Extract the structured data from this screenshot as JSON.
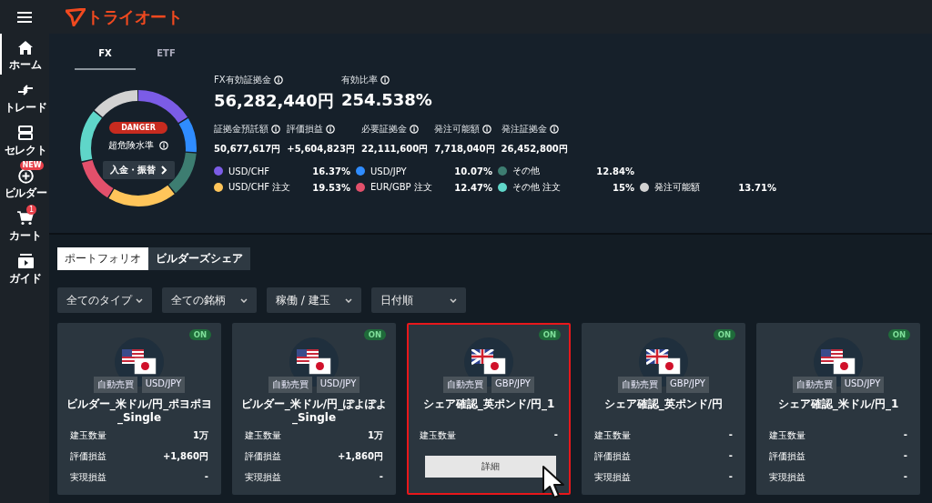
{
  "header": {
    "logo": "トライオート"
  },
  "sidebar": {
    "items": [
      {
        "label": "ホーム",
        "selected": true
      },
      {
        "label": "トレード",
        "selected": false
      },
      {
        "label": "セレクト",
        "selected": false
      },
      {
        "label": "ビルダー",
        "selected": false,
        "badge": "NEW"
      },
      {
        "label": "カート",
        "selected": false,
        "count": "1"
      },
      {
        "label": "ガイド",
        "selected": false
      }
    ]
  },
  "asset_tabs": [
    {
      "label": "FX",
      "selected": true
    },
    {
      "label": "ETF",
      "selected": false
    }
  ],
  "risk": {
    "badge": "DANGER",
    "level_text": "超危険水準",
    "button": "入金・振替"
  },
  "summary": [
    {
      "label": "FX有効証拠金",
      "value": "56,282,440円"
    },
    {
      "label": "有効比率",
      "value": "254.538%"
    }
  ],
  "details": [
    {
      "label": "証拠金預託額",
      "value": "50,677,617円"
    },
    {
      "label": "評価損益",
      "value": "+5,604,823円"
    },
    {
      "label": "必要証拠金",
      "value": "22,111,600円"
    },
    {
      "label": "発注可能額",
      "value": "7,718,040円"
    },
    {
      "label": "発注証拠金",
      "value": "26,452,800円"
    }
  ],
  "legend_rows": [
    [
      {
        "label": "USD/CHF",
        "percent": "16.37%",
        "color": "#7b5ce6"
      },
      {
        "label": "USD/JPY",
        "percent": "10.07%",
        "color": "#2f8cff"
      },
      {
        "label": "その他",
        "percent": "12.84%",
        "color": "#3d7d71"
      }
    ],
    [
      {
        "label": "USD/CHF 注文",
        "percent": "19.53%",
        "color": "#ffc55a"
      },
      {
        "label": "EUR/GBP 注文",
        "percent": "12.47%",
        "color": "#e2506b"
      },
      {
        "label": "その他 注文",
        "percent": "15%",
        "color": "#5fd6c9"
      },
      {
        "label": "発注可能額",
        "percent": "13.71%",
        "color": "#d2d2d2"
      }
    ]
  ],
  "view_tabs": [
    {
      "label": "ポートフォリオ",
      "selected": true
    },
    {
      "label": "ビルダーズシェア",
      "selected": false
    }
  ],
  "filters": [
    "全てのタイプ",
    "全ての銘柄",
    "稼働 / 建玉",
    "日付順"
  ],
  "cards": [
    {
      "status": "ON",
      "kind": "usd",
      "type": "自動売買",
      "pair": "USD/JPY",
      "title": "ビルダー_米ドル/円_ポヨポヨ_Single",
      "highlighted": false,
      "stats": [
        {
          "label": "建玉数量",
          "value": "1万"
        },
        {
          "label": "評価損益",
          "value": "+1,860円"
        },
        {
          "label": "実現損益",
          "value": "-"
        }
      ]
    },
    {
      "status": "ON",
      "kind": "usd",
      "type": "自動売買",
      "pair": "USD/JPY",
      "title": "ビルダー_米ドル/円_ぽよぽよ_Single",
      "highlighted": false,
      "stats": [
        {
          "label": "建玉数量",
          "value": "1万"
        },
        {
          "label": "評価損益",
          "value": "+1,860円"
        },
        {
          "label": "実現損益",
          "value": "-"
        }
      ]
    },
    {
      "status": "ON",
      "kind": "gbp",
      "type": "自動売買",
      "pair": "GBP/JPY",
      "title": "シェア確認_英ポンド/円_1",
      "highlighted": true,
      "detail_button": "詳細",
      "stats": [
        {
          "label": "建玉数量",
          "value": "-"
        }
      ]
    },
    {
      "status": "ON",
      "kind": "gbp",
      "type": "自動売買",
      "pair": "GBP/JPY",
      "title": "シェア確認_英ポンド/円",
      "highlighted": false,
      "stats": [
        {
          "label": "建玉数量",
          "value": "-"
        },
        {
          "label": "評価損益",
          "value": "-"
        },
        {
          "label": "実現損益",
          "value": "-"
        }
      ]
    },
    {
      "status": "ON",
      "kind": "usd",
      "type": "自動売買",
      "pair": "USD/JPY",
      "title": "シェア確認_米ドル/円_1",
      "highlighted": false,
      "stats": [
        {
          "label": "建玉数量",
          "value": "-"
        },
        {
          "label": "評価損益",
          "value": "-"
        },
        {
          "label": "実現損益",
          "value": "-"
        }
      ]
    }
  ]
}
